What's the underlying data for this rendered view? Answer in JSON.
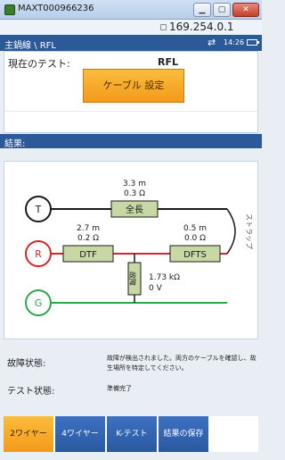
{
  "window": {
    "title": "MAXT000966236",
    "minimize": "▁",
    "maximize": "▢",
    "close": "✕"
  },
  "address": {
    "ip": "169.254.0.1"
  },
  "header": {
    "breadcrumb": "主鍋線 \\ RFL",
    "time": "14:26"
  },
  "current_test": {
    "label": "現在のテスト:",
    "value": "RFL",
    "button": "ケーブル 設定"
  },
  "results": {
    "label": "結果:"
  },
  "diagram": {
    "nodes": {
      "t": "T",
      "r": "R",
      "g": "G"
    },
    "full_length": {
      "distance": "3.3 m",
      "resistance": "0.3 Ω",
      "label": "全長"
    },
    "dtf": {
      "distance": "2.7 m",
      "resistance": "0.2 Ω",
      "label": "DTF"
    },
    "dfts": {
      "distance": "0.5 m",
      "resistance": "0.0 Ω",
      "label": "DFTS"
    },
    "leak": {
      "label": "故障",
      "resistance": "1.73 kΩ",
      "voltage": "0 V"
    },
    "strap": "ストラップ",
    "colors": {
      "t": "#1a1a1a",
      "r": "#d9252a",
      "g": "#2aa84a",
      "box": "#c8d8a4"
    }
  },
  "status": {
    "fault_label": "故障状態:",
    "fault_text_1": "故障が検出されました。両方のケーブルを確認し、故",
    "fault_text_2": "生場所を特定してください。",
    "test_label": "テスト状態:",
    "test_text": "準備完了"
  },
  "tabs": [
    {
      "label": "2ワイヤー",
      "active": true
    },
    {
      "label": "4ワイヤー",
      "active": false
    },
    {
      "label": "K-テスト",
      "active": false
    },
    {
      "label": "結果の保存",
      "active": false
    }
  ]
}
